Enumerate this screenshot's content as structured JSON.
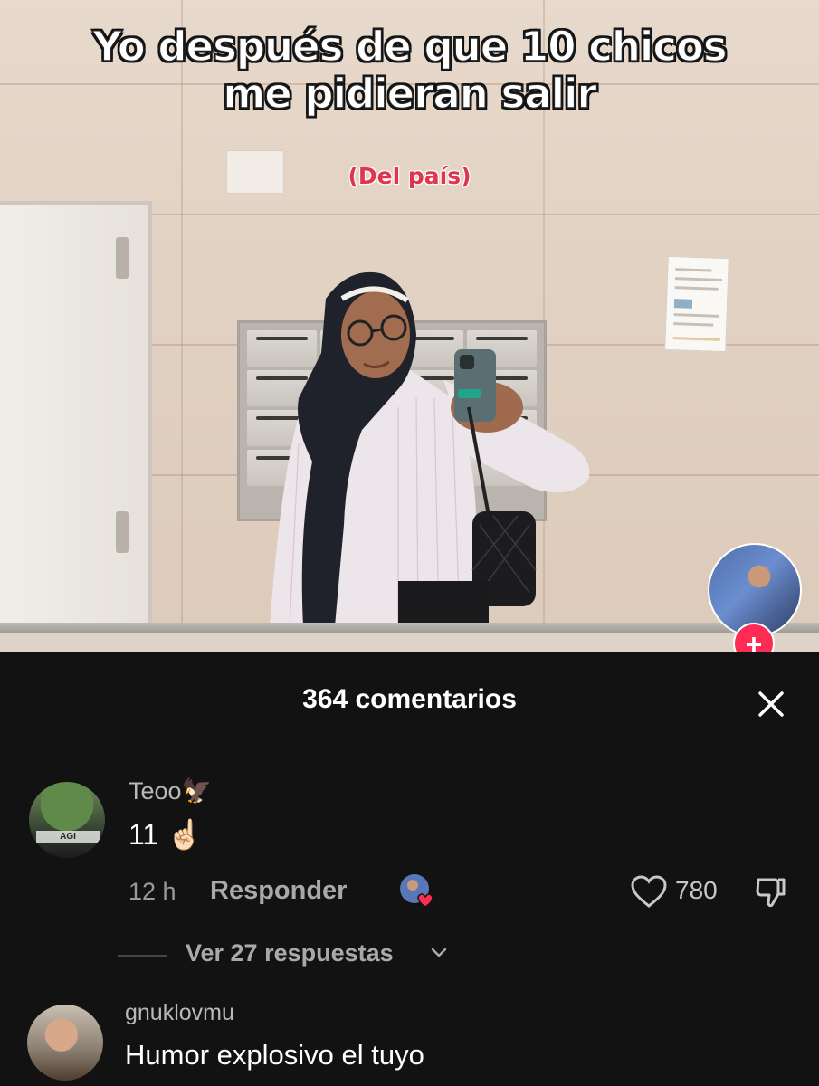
{
  "video": {
    "caption_line1": "Yo después de que 10 chicos",
    "caption_line2": "me pidieran salir",
    "subcaption": "(Del país)",
    "follow_label": "+"
  },
  "comments_sheet": {
    "title": "364 comentarios",
    "close_icon": "close-icon",
    "comments": [
      {
        "username": "Teoo🦅",
        "text": "11 ☝🏻",
        "time": "12 h",
        "reply_label": "Responder",
        "likes": "780",
        "liked_by_creator": true,
        "view_replies_label": "Ver 27 respuestas"
      },
      {
        "username": "gnuklovmu",
        "text": "Humor explosivo el tuyo"
      }
    ]
  },
  "colors": {
    "sheet_bg": "#121212",
    "follow_accent": "#fe2c55",
    "subcaption": "#e0364d"
  }
}
